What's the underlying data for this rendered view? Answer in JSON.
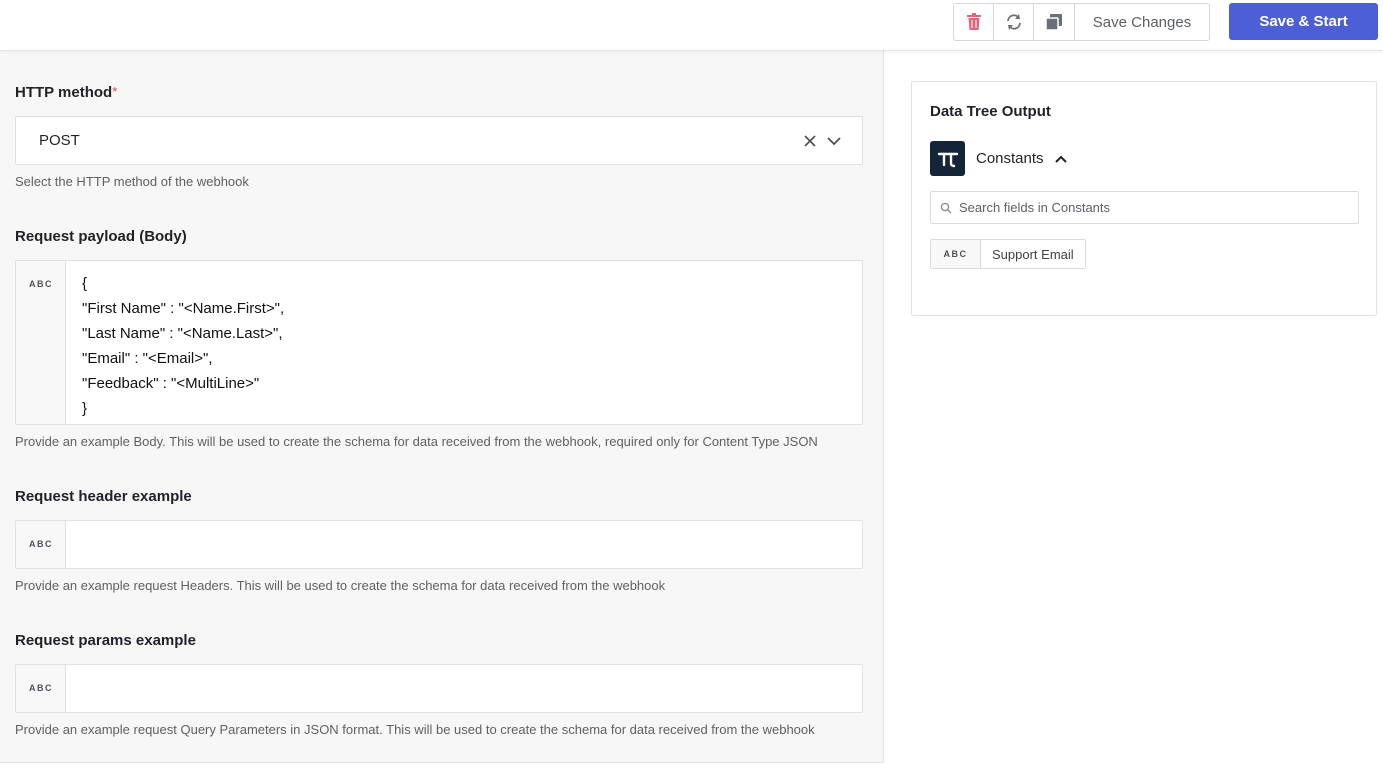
{
  "toolbar": {
    "delete_icon": "trash-icon",
    "refresh_icon": "refresh-icon",
    "duplicate_icon": "copy-icon",
    "save_changes_label": "Save Changes",
    "save_start_label": "Save & Start",
    "accent_color": "#4c5fd5",
    "delete_color": "#e0647c"
  },
  "form": {
    "http_method": {
      "label": "HTTP method",
      "required_mark": "*",
      "value": "POST",
      "help": "Select the HTTP method of the webhook"
    },
    "body": {
      "label": "Request payload (Body)",
      "type_badge": "ABC",
      "value": "{\n\"First Name\" : \"<Name.First>\",\n\"Last Name\" : \"<Name.Last>\",\n\"Email\" : \"<Email>\",\n\"Feedback\" : \"<MultiLine>\"\n}",
      "help": "Provide an example Body. This will be used to create the schema for data received from the webhook, required only for Content Type JSON"
    },
    "headers": {
      "label": "Request header example",
      "type_badge": "ABC",
      "value": "",
      "help": "Provide an example request Headers. This will be used to create the schema for data received from the webhook"
    },
    "params": {
      "label": "Request params example",
      "type_badge": "ABC",
      "value": "",
      "help": "Provide an example request Query Parameters in JSON format. This will be used to create the schema for data received from the webhook"
    }
  },
  "data_tree": {
    "title": "Data Tree Output",
    "group": {
      "icon": "pi-icon",
      "label": "Constants",
      "expanded": true
    },
    "search_placeholder": "Search fields in Constants",
    "fields": [
      {
        "type": "ABC",
        "label": "Support Email"
      }
    ]
  }
}
